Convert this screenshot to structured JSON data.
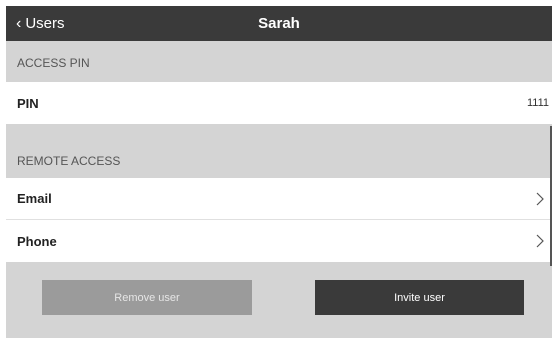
{
  "nav": {
    "back_label": "Users",
    "title": "Sarah"
  },
  "access_pin": {
    "header": "ACCESS PIN",
    "pin_label": "PIN",
    "pin_value": "1111"
  },
  "remote_access": {
    "header": "REMOTE ACCESS",
    "items": [
      {
        "label": "Email",
        "icon": "chevron-right-icon"
      },
      {
        "label": "Phone",
        "icon": "chevron-right-icon"
      }
    ]
  },
  "actions": {
    "remove_label": "Remove user",
    "invite_label": "Invite user"
  },
  "colors": {
    "nav_bg": "#3a3a3a",
    "section_bg": "#d4d4d4",
    "remove_bg": "#9b9b9b",
    "invite_bg": "#3a3a3a"
  }
}
